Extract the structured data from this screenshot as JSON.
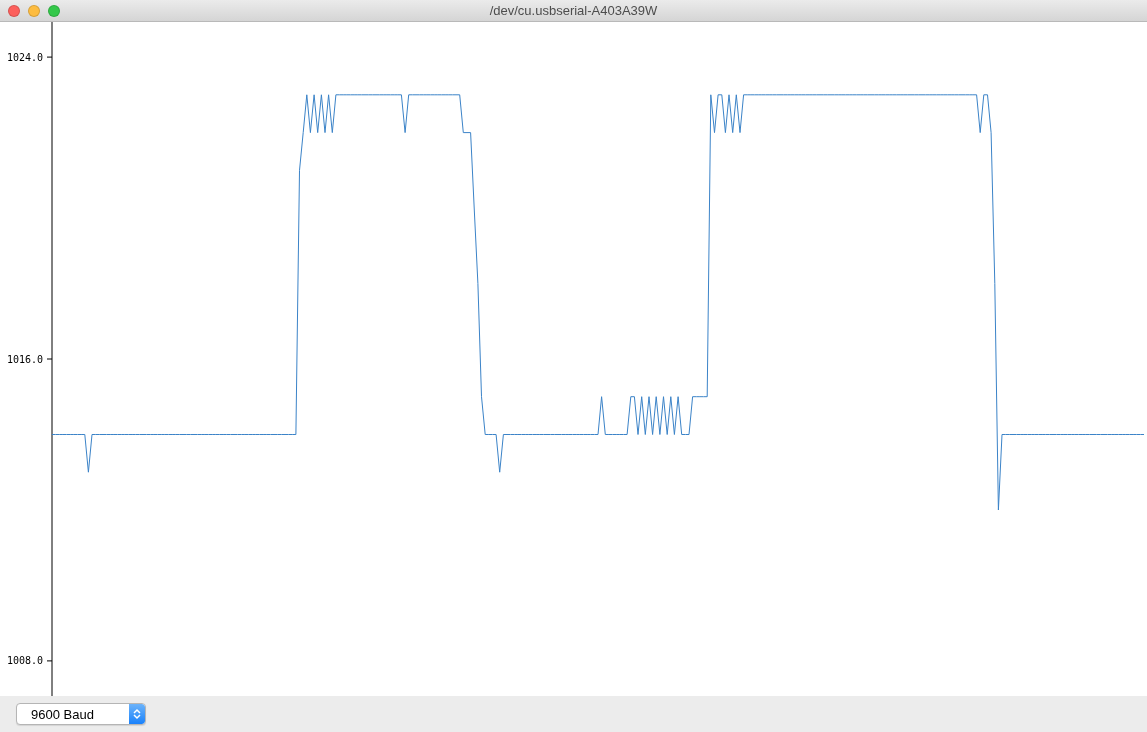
{
  "window": {
    "title": "/dev/cu.usbserial-A403A39W"
  },
  "plot": {
    "chart_data": {
      "type": "line",
      "ylim": [
        1007.07,
        1024.93
      ],
      "yticks": [
        {
          "value": 1024,
          "label": "1024.0"
        },
        {
          "value": 1016,
          "label": "1016.0"
        },
        {
          "value": 1008,
          "label": "1008.0"
        }
      ],
      "categories": [
        null,
        null,
        null,
        null,
        null,
        null,
        null,
        null,
        null,
        null,
        null,
        null,
        null,
        null,
        null,
        null,
        null,
        null,
        null,
        null,
        null,
        null,
        null,
        null,
        null,
        null,
        null,
        null,
        null,
        null,
        null,
        null,
        null,
        null,
        null,
        null,
        null,
        null,
        null,
        null,
        null,
        null,
        null,
        null,
        null,
        null,
        null,
        null,
        null,
        null,
        null,
        null,
        null,
        null,
        null,
        null,
        null,
        null,
        null,
        null,
        null,
        null,
        null,
        null,
        null,
        null,
        null,
        null,
        null,
        null,
        null,
        null,
        null,
        null,
        null,
        null,
        null,
        null,
        null,
        null,
        null,
        null,
        null,
        null,
        null,
        null,
        null,
        null,
        null,
        null,
        null,
        null,
        null,
        null,
        null,
        null,
        null,
        null,
        null,
        null,
        null,
        null,
        null,
        null,
        null,
        null,
        null,
        null,
        null,
        null,
        null,
        null,
        null,
        null,
        null,
        null,
        null,
        null,
        null,
        null,
        null,
        null,
        null,
        null,
        null,
        null,
        null,
        null,
        null,
        null,
        null,
        null,
        null,
        null,
        null,
        null,
        null,
        null,
        null,
        null,
        null,
        null,
        null,
        null,
        null,
        null,
        null,
        null,
        null,
        null,
        null,
        null,
        null,
        null,
        null,
        null,
        null,
        null,
        null,
        null,
        null,
        null,
        null,
        null,
        null,
        null,
        null,
        null,
        null,
        null,
        null,
        null,
        null,
        null,
        null,
        null,
        null,
        null,
        null,
        null,
        null,
        null,
        null,
        null,
        null,
        null,
        null,
        null,
        null,
        null,
        null,
        null,
        null,
        null,
        null,
        null,
        null,
        null,
        null,
        null,
        null,
        null,
        null,
        null,
        null,
        null,
        null,
        null,
        null,
        null,
        null,
        null,
        null,
        null,
        null,
        null,
        null,
        null,
        null,
        null,
        null,
        null,
        null,
        null,
        null,
        null,
        null,
        null,
        null,
        null,
        null,
        null,
        null,
        null,
        null,
        null,
        null,
        null,
        null,
        null,
        null,
        null,
        null,
        null,
        null,
        null,
        null,
        null,
        null,
        null,
        null,
        null,
        null,
        null,
        null,
        null,
        null,
        null,
        null,
        null,
        null,
        null,
        null,
        null,
        null,
        null,
        null,
        null,
        null,
        null,
        null,
        null,
        null,
        null,
        null,
        null,
        null,
        null,
        null,
        null,
        null,
        null,
        null,
        null,
        null,
        null,
        null,
        null,
        null,
        null,
        null,
        null,
        null,
        null,
        null,
        null,
        null,
        null,
        null,
        null,
        null
      ],
      "series": [
        {
          "color": "#3b83c8",
          "values": [
            1014,
            1014,
            1014,
            1014,
            1014,
            1014,
            1014,
            1014,
            1014,
            1014,
            1013,
            1014,
            1014,
            1014,
            1014,
            1014,
            1014,
            1014,
            1014,
            1014,
            1014,
            1014,
            1014,
            1014,
            1014,
            1014,
            1014,
            1014,
            1014,
            1014,
            1014,
            1014,
            1014,
            1014,
            1014,
            1014,
            1014,
            1014,
            1014,
            1014,
            1014,
            1014,
            1014,
            1014,
            1014,
            1014,
            1014,
            1014,
            1014,
            1014,
            1014,
            1014,
            1014,
            1014,
            1014,
            1014,
            1014,
            1014,
            1014,
            1014,
            1014,
            1014,
            1014,
            1014,
            1014,
            1014,
            1014,
            1014,
            1021,
            1022,
            1023,
            1022,
            1023,
            1022,
            1023,
            1022,
            1023,
            1022,
            1023,
            1023,
            1023,
            1023,
            1023,
            1023,
            1023,
            1023,
            1023,
            1023,
            1023,
            1023,
            1023,
            1023,
            1023,
            1023,
            1023,
            1023,
            1023,
            1022,
            1023,
            1023,
            1023,
            1023,
            1023,
            1023,
            1023,
            1023,
            1023,
            1023,
            1023,
            1023,
            1023,
            1023,
            1023,
            1022,
            1022,
            1022,
            1020,
            1018,
            1015,
            1014,
            1014,
            1014,
            1014,
            1013,
            1014,
            1014,
            1014,
            1014,
            1014,
            1014,
            1014,
            1014,
            1014,
            1014,
            1014,
            1014,
            1014,
            1014,
            1014,
            1014,
            1014,
            1014,
            1014,
            1014,
            1014,
            1014,
            1014,
            1014,
            1014,
            1014,
            1014,
            1015,
            1014,
            1014,
            1014,
            1014,
            1014,
            1014,
            1014,
            1015,
            1015,
            1014,
            1015,
            1014,
            1015,
            1014,
            1015,
            1014,
            1015,
            1014,
            1015,
            1014,
            1015,
            1014,
            1014,
            1014,
            1015,
            1015,
            1015,
            1015,
            1015,
            1023,
            1022,
            1023,
            1023,
            1022,
            1023,
            1022,
            1023,
            1022,
            1023,
            1023,
            1023,
            1023,
            1023,
            1023,
            1023,
            1023,
            1023,
            1023,
            1023,
            1023,
            1023,
            1023,
            1023,
            1023,
            1023,
            1023,
            1023,
            1023,
            1023,
            1023,
            1023,
            1023,
            1023,
            1023,
            1023,
            1023,
            1023,
            1023,
            1023,
            1023,
            1023,
            1023,
            1023,
            1023,
            1023,
            1023,
            1023,
            1023,
            1023,
            1023,
            1023,
            1023,
            1023,
            1023,
            1023,
            1023,
            1023,
            1023,
            1023,
            1023,
            1023,
            1023,
            1023,
            1023,
            1023,
            1023,
            1023,
            1023,
            1023,
            1023,
            1023,
            1023,
            1023,
            1022,
            1023,
            1023,
            1022,
            1018,
            1012,
            1014,
            1014,
            1014,
            1014,
            1014,
            1014,
            1014,
            1014,
            1014,
            1014,
            1014,
            1014,
            1014,
            1014,
            1014,
            1014,
            1014,
            1014,
            1014,
            1014,
            1014,
            1014,
            1014,
            1014,
            1014,
            1014,
            1014,
            1014,
            1014,
            1014,
            1014,
            1014,
            1014,
            1014,
            1014,
            1014,
            1014,
            1014,
            1014,
            1014
          ]
        }
      ]
    }
  },
  "footer": {
    "baud_select": {
      "value": "9600 Baud"
    }
  }
}
